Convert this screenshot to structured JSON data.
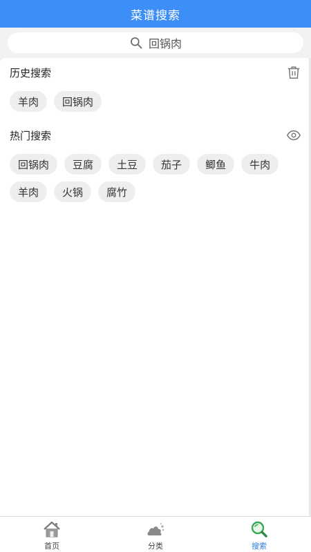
{
  "header": {
    "title": "菜谱搜索"
  },
  "search": {
    "value": "回锅肉",
    "icon": "search-icon"
  },
  "history": {
    "title": "历史搜索",
    "icon": "trash-icon",
    "items": [
      "羊肉",
      "回锅肉"
    ]
  },
  "hot": {
    "title": "热门搜索",
    "icon": "eye-icon",
    "items": [
      "回锅肉",
      "豆腐",
      "土豆",
      "茄子",
      "鲫鱼",
      "牛肉",
      "羊肉",
      "火锅",
      "腐竹"
    ]
  },
  "tabbar": {
    "active": "搜索",
    "tabs": [
      {
        "label": "首页",
        "icon": "home-icon"
      },
      {
        "label": "分类",
        "icon": "category-icon"
      },
      {
        "label": "搜索",
        "icon": "search-tab-icon"
      }
    ]
  },
  "colors": {
    "accent": "#3d8ef7",
    "active_tab": "#2a7de1",
    "tag_bg": "#eeeeee"
  }
}
